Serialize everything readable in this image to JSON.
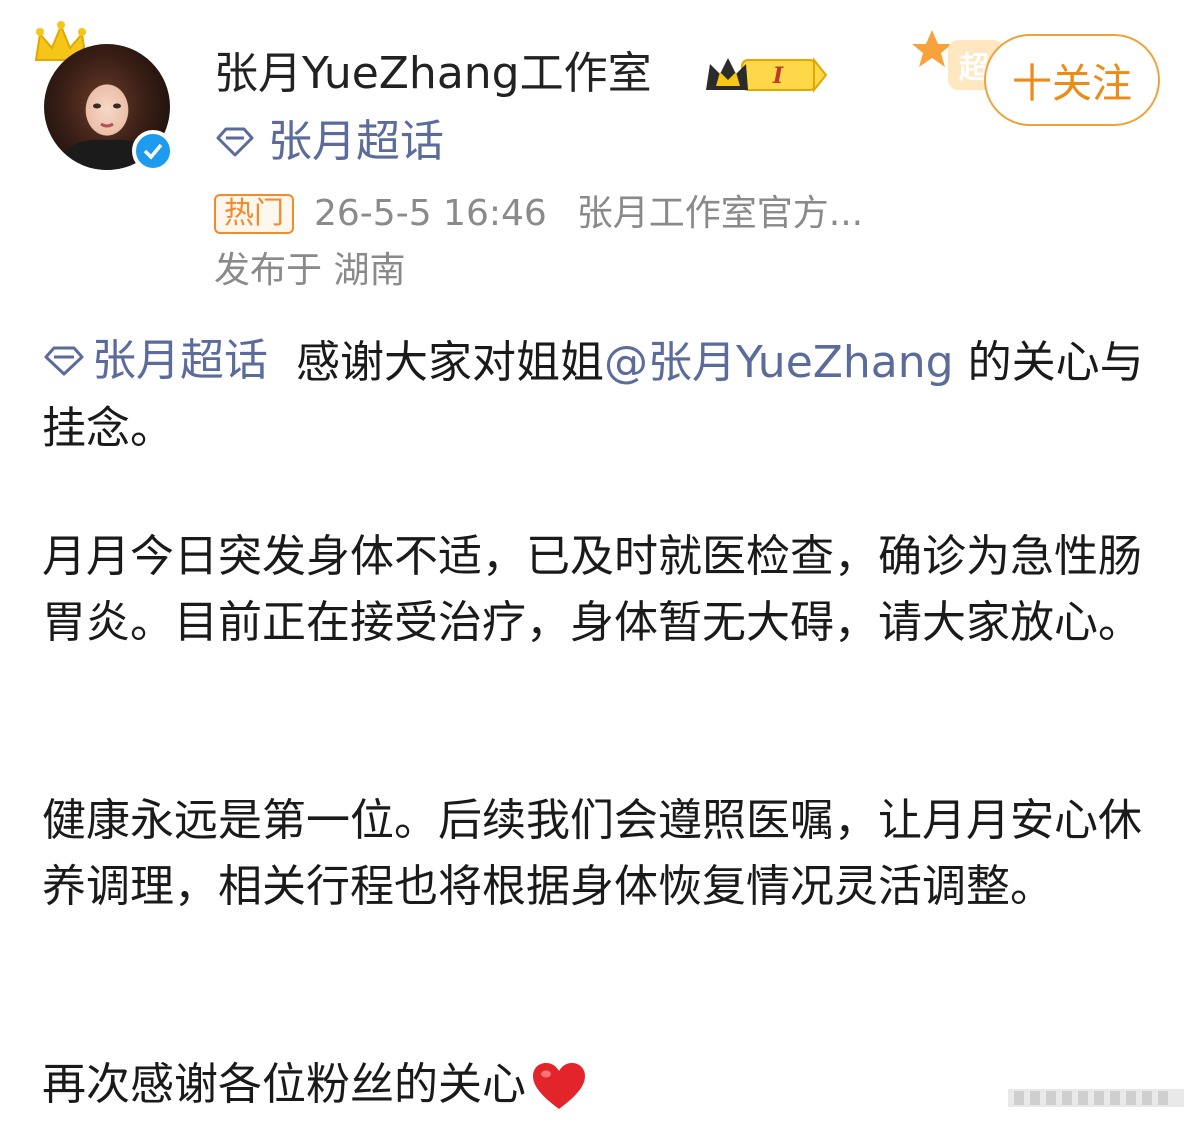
{
  "post": {
    "username": "张月YueZhang工作室",
    "level_badge": "I",
    "topic": "张月超话",
    "follow_button": "十关注",
    "hot_tag": "热门",
    "timestamp": "26-5-5 16:46",
    "source": "张月工作室官方...",
    "location": "发布于 湖南",
    "super_badge_char": "超"
  },
  "content": {
    "p1_topic": "张月超话",
    "p1_text_a": "感谢大家对姐姐",
    "p1_mention": "@张月YueZhang",
    "p1_text_b": " 的关心与挂念。",
    "p2": "月月今日突发身体不适，已及时就医检查，确诊为急性肠胃炎。目前正在接受治疗，身体暂无大碍，请大家放心。",
    "p3": "健康永远是第一位。后续我们会遵照医嘱，让月月安心休养调理，相关行程也将根据身体恢复情况灵活调整。",
    "p4": "再次感谢各位粉丝的关心"
  },
  "colors": {
    "link_blue": "#5b6b9b",
    "follow_orange": "#ee8a16",
    "verified_blue": "#1d9bf0",
    "meta_gray": "#8a8a8a"
  },
  "icons": {
    "crown": "crown-icon",
    "verified": "verified-icon",
    "level": "level-badge-icon",
    "topic": "diamond-icon",
    "heart": "heart-icon",
    "watermark": "watermark-icon"
  }
}
